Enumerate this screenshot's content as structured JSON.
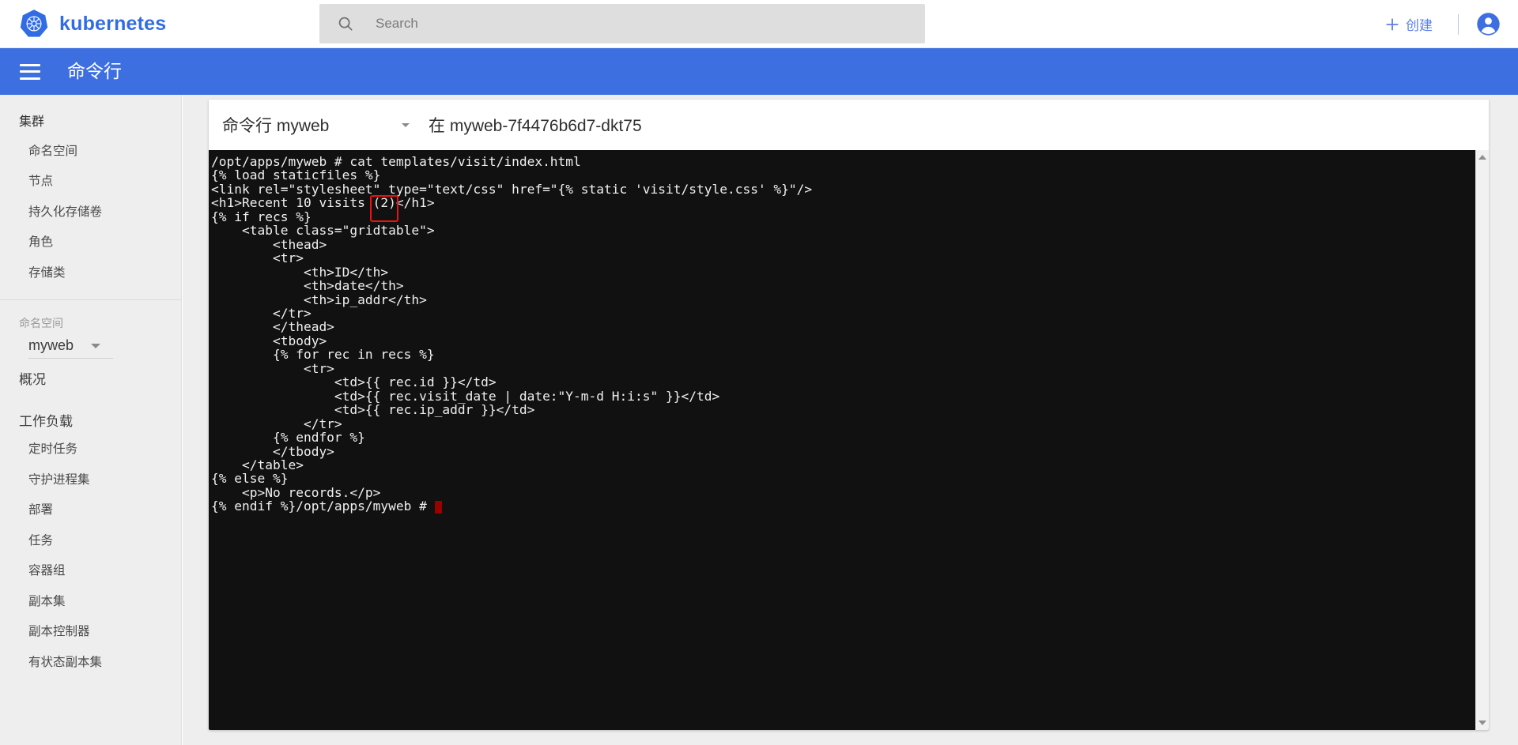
{
  "topbar": {
    "brand_name": "kubernetes",
    "logo_icon": "kubernetes-helm-icon",
    "search": {
      "icon": "search-icon",
      "placeholder": "Search",
      "value": ""
    },
    "create_label": "创建",
    "create_icon": "plus-icon",
    "account_icon": "account-circle-icon"
  },
  "subheader": {
    "menu_icon": "hamburger-menu-icon",
    "title": "命令行"
  },
  "sidebar": {
    "cluster_group": {
      "title": "集群",
      "items": [
        {
          "label": "命名空间"
        },
        {
          "label": "节点"
        },
        {
          "label": "持久化存储卷"
        },
        {
          "label": "角色"
        },
        {
          "label": "存储类"
        }
      ]
    },
    "namespace_section": {
      "label": "命名空间",
      "selected": "myweb",
      "caret_icon": "chevron-down-icon"
    },
    "overview_label": "概况",
    "workload_group": {
      "title": "工作负载",
      "items": [
        {
          "label": "定时任务"
        },
        {
          "label": "守护进程集"
        },
        {
          "label": "部署"
        },
        {
          "label": "任务"
        },
        {
          "label": "容器组"
        },
        {
          "label": "副本集"
        },
        {
          "label": "副本控制器"
        },
        {
          "label": "有状态副本集"
        }
      ]
    }
  },
  "main": {
    "card_header": {
      "select_label": "命令行 myweb",
      "select_caret_icon": "chevron-down-icon",
      "pod_label": "在 myweb-7f4476b6d7-dkt75"
    },
    "terminal": {
      "background_color": "#111111",
      "text_color": "#f0f0f0",
      "cursor_color": "#990000",
      "highlight_color": "#ee1111",
      "highlight_target": "(2)",
      "content": "/opt/apps/myweb # cat templates/visit/index.html\n{% load staticfiles %}\n<link rel=\"stylesheet\" type=\"text/css\" href=\"{% static 'visit/style.css' %}\"/>\n<h1>Recent 10 visits (2)</h1>\n{% if recs %}\n    <table class=\"gridtable\">\n        <thead>\n        <tr>\n            <th>ID</th>\n            <th>date</th>\n            <th>ip_addr</th>\n        </tr>\n        </thead>\n        <tbody>\n        {% for rec in recs %}\n            <tr>\n                <td>{{ rec.id }}</td>\n                <td>{{ rec.visit_date | date:\"Y-m-d H:i:s\" }}</td>\n                <td>{{ rec.ip_addr }}</td>\n            </tr>\n        {% endfor %}\n        </tbody>\n    </table>\n{% else %}\n    <p>No records.</p>\n{% endif %}/opt/apps/myweb # ",
      "scrollbar": {
        "up_icon": "scroll-up-arrow-icon",
        "down_icon": "scroll-down-arrow-icon"
      }
    }
  },
  "colors": {
    "brand_blue": "#326ce5",
    "header_blue": "#3d6fe0",
    "sidebar_bg": "#eeeeee",
    "terminal_bg": "#111111"
  }
}
